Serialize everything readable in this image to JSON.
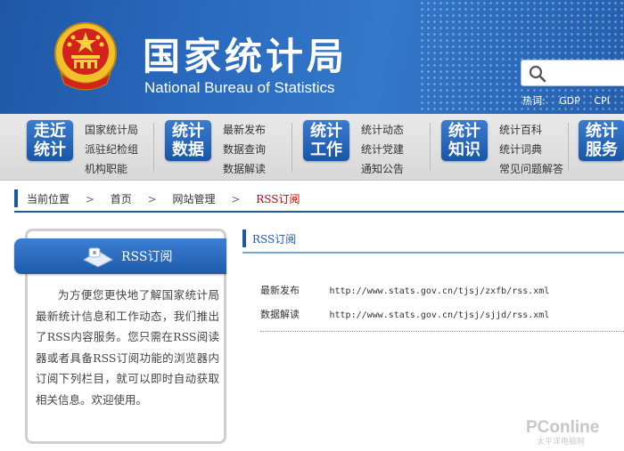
{
  "header": {
    "title_cn": "国家统计局",
    "title_en": "National Bureau of Statistics",
    "hotwords_label": "热词:",
    "hotwords": [
      "GDP",
      "CPI",
      "PP"
    ]
  },
  "nav": [
    {
      "badge": "走近统计",
      "links": [
        "国家统计局",
        "派驻纪检组",
        "机构职能"
      ]
    },
    {
      "badge": "统计数据",
      "links": [
        "最新发布",
        "数据查询",
        "数据解读"
      ]
    },
    {
      "badge": "统计工作",
      "links": [
        "统计动态",
        "统计党建",
        "通知公告"
      ]
    },
    {
      "badge": "统计知识",
      "links": [
        "统计百科",
        "统计词典",
        "常见问题解答"
      ]
    },
    {
      "badge": "统计服务",
      "links": []
    }
  ],
  "breadcrumb": {
    "label": "当前位置",
    "items": [
      "首页",
      "网站管理",
      "RSS订阅"
    ]
  },
  "left_panel": {
    "tab_label": "RSS订阅",
    "description": "为方便您更快地了解国家统计局最新统计信息和工作动态，我们推出了RSS内容服务。您只需在RSS阅读器或者具备RSS订阅功能的浏览器内订阅下列栏目，就可以即时自动获取相关信息。欢迎使用。"
  },
  "content": {
    "title": "RSS订阅",
    "feeds": [
      {
        "name": "最新发布",
        "url": "http://www.stats.gov.cn/tjsj/zxfb/rss.xml"
      },
      {
        "name": "数据解读",
        "url": "http://www.stats.gov.cn/tjsj/sjjd/rss.xml"
      }
    ]
  },
  "watermark": "PConline 太平洋电脑网",
  "colors": {
    "brand_blue": "#1f57a6",
    "current_red": "#cc0000"
  }
}
